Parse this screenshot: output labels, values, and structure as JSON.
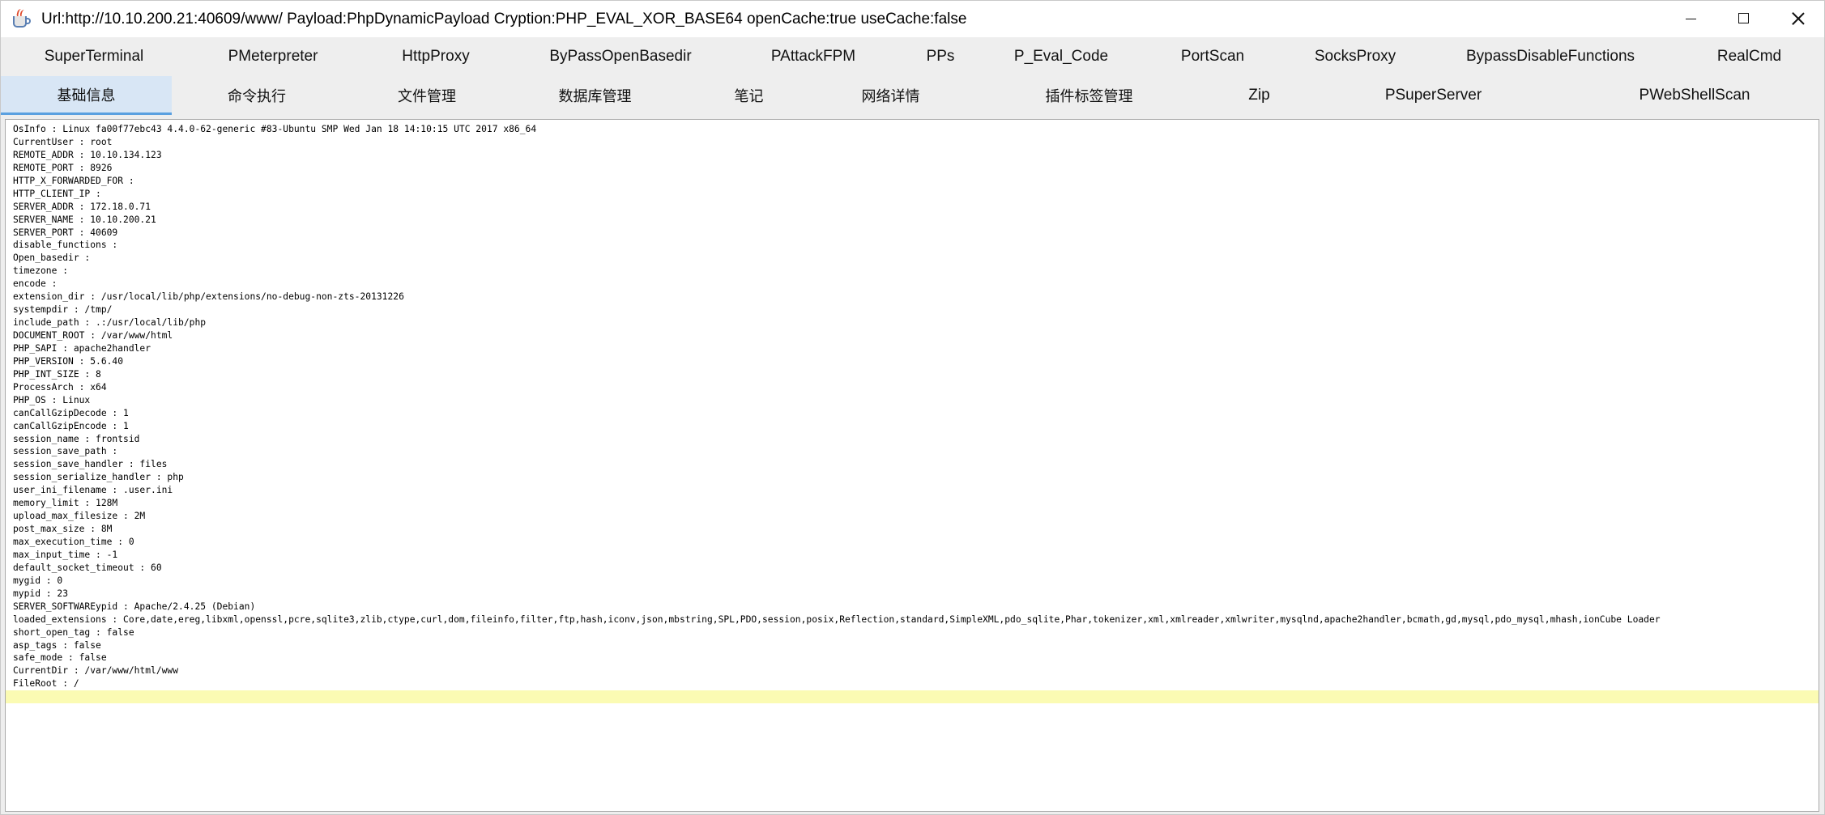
{
  "window": {
    "title": "Url:http://10.10.200.21:40609/www/ Payload:PhpDynamicPayload Cryption:PHP_EVAL_XOR_BASE64 openCache:true useCache:false",
    "app_icon": "java-cup-icon"
  },
  "tabs_row1": [
    {
      "label": "SuperTerminal"
    },
    {
      "label": "PMeterpreter"
    },
    {
      "label": "HttpProxy"
    },
    {
      "label": "ByPassOpenBasedir"
    },
    {
      "label": "PAttackFPM"
    },
    {
      "label": "PPs"
    },
    {
      "label": "P_Eval_Code"
    },
    {
      "label": "PortScan"
    },
    {
      "label": "SocksProxy"
    },
    {
      "label": "BypassDisableFunctions"
    },
    {
      "label": "RealCmd"
    }
  ],
  "tabs_row2": [
    {
      "label": "基础信息",
      "selected": true
    },
    {
      "label": "命令执行"
    },
    {
      "label": "文件管理"
    },
    {
      "label": "数据库管理"
    },
    {
      "label": "笔记"
    },
    {
      "label": "网络详情"
    },
    {
      "label": "插件标签管理"
    },
    {
      "label": "Zip"
    },
    {
      "label": "PSuperServer"
    },
    {
      "label": "PWebShellScan"
    }
  ],
  "colors": {
    "selected_tab_bg": "#d8e6f5",
    "selected_tab_underline": "#5aa0e0",
    "caret_line_highlight": "#fbfbb3"
  },
  "info_lines": [
    "OsInfo : Linux fa00f77ebc43 4.4.0-62-generic #83-Ubuntu SMP Wed Jan 18 14:10:15 UTC 2017 x86_64",
    "CurrentUser : root",
    "REMOTE_ADDR : 10.10.134.123",
    "REMOTE_PORT : 8926",
    "HTTP_X_FORWARDED_FOR :",
    "HTTP_CLIENT_IP :",
    "SERVER_ADDR : 172.18.0.71",
    "SERVER_NAME : 10.10.200.21",
    "SERVER_PORT : 40609",
    "disable_functions :",
    "Open_basedir :",
    "timezone :",
    "encode :",
    "extension_dir : /usr/local/lib/php/extensions/no-debug-non-zts-20131226",
    "systempdir : /tmp/",
    "include_path : .:/usr/local/lib/php",
    "DOCUMENT_ROOT : /var/www/html",
    "PHP_SAPI : apache2handler",
    "PHP_VERSION : 5.6.40",
    "PHP_INT_SIZE : 8",
    "ProcessArch : x64",
    "PHP_OS : Linux",
    "canCallGzipDecode : 1",
    "canCallGzipEncode : 1",
    "session_name : frontsid",
    "session_save_path :",
    "session_save_handler : files",
    "session_serialize_handler : php",
    "user_ini_filename : .user.ini",
    "memory_limit : 128M",
    "upload_max_filesize : 2M",
    "post_max_size : 8M",
    "max_execution_time : 0",
    "max_input_time : -1",
    "default_socket_timeout : 60",
    "mygid : 0",
    "mypid : 23",
    "SERVER_SOFTWAREypid : Apache/2.4.25 (Debian)",
    "loaded_extensions : Core,date,ereg,libxml,openssl,pcre,sqlite3,zlib,ctype,curl,dom,fileinfo,filter,ftp,hash,iconv,json,mbstring,SPL,PDO,session,posix,Reflection,standard,SimpleXML,pdo_sqlite,Phar,tokenizer,xml,xmlreader,xmlwriter,mysqlnd,apache2handler,bcmath,gd,mysql,pdo_mysql,mhash,ionCube Loader",
    "short_open_tag : false",
    "asp_tags : false",
    "safe_mode : false",
    "CurrentDir : /var/www/html/www",
    "FileRoot : /"
  ]
}
